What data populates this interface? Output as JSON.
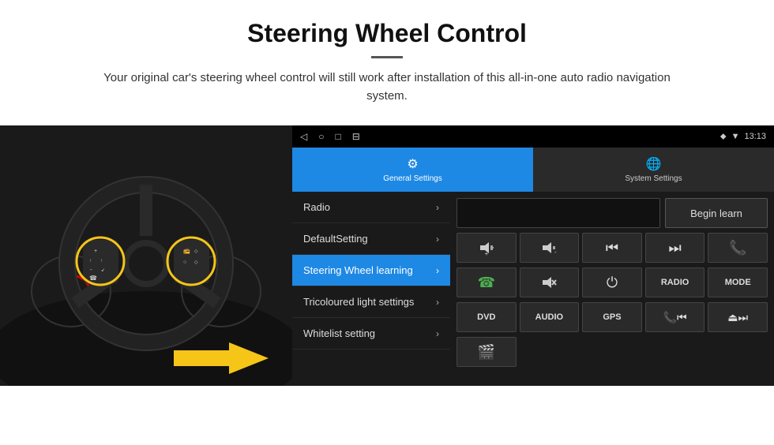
{
  "header": {
    "title": "Steering Wheel Control",
    "subtitle": "Your original car's steering wheel control will still work after installation of this all-in-one auto radio navigation system."
  },
  "android": {
    "topbar": {
      "nav_icons": [
        "◁",
        "○",
        "□",
        "⊟"
      ],
      "status_icons": [
        "⬥",
        "▼"
      ],
      "time": "13:13"
    },
    "tabs": [
      {
        "label": "General Settings",
        "active": true
      },
      {
        "label": "System Settings",
        "active": false
      }
    ],
    "menu_items": [
      {
        "label": "Radio",
        "active": false
      },
      {
        "label": "DefaultSetting",
        "active": false
      },
      {
        "label": "Steering Wheel learning",
        "active": true
      },
      {
        "label": "Tricoloured light settings",
        "active": false
      },
      {
        "label": "Whitelist setting",
        "active": false
      }
    ],
    "controls": {
      "begin_learn_label": "Begin learn",
      "row1": [
        "🔊+",
        "🔊-",
        "⏮",
        "⏭",
        "📞"
      ],
      "row2": [
        "☎",
        "🔇",
        "⏻",
        "RADIO",
        "MODE"
      ],
      "row3": [
        "DVD",
        "AUDIO",
        "GPS",
        "📞⏮",
        "⏏⏭"
      ],
      "row4": [
        "🎬"
      ]
    }
  }
}
